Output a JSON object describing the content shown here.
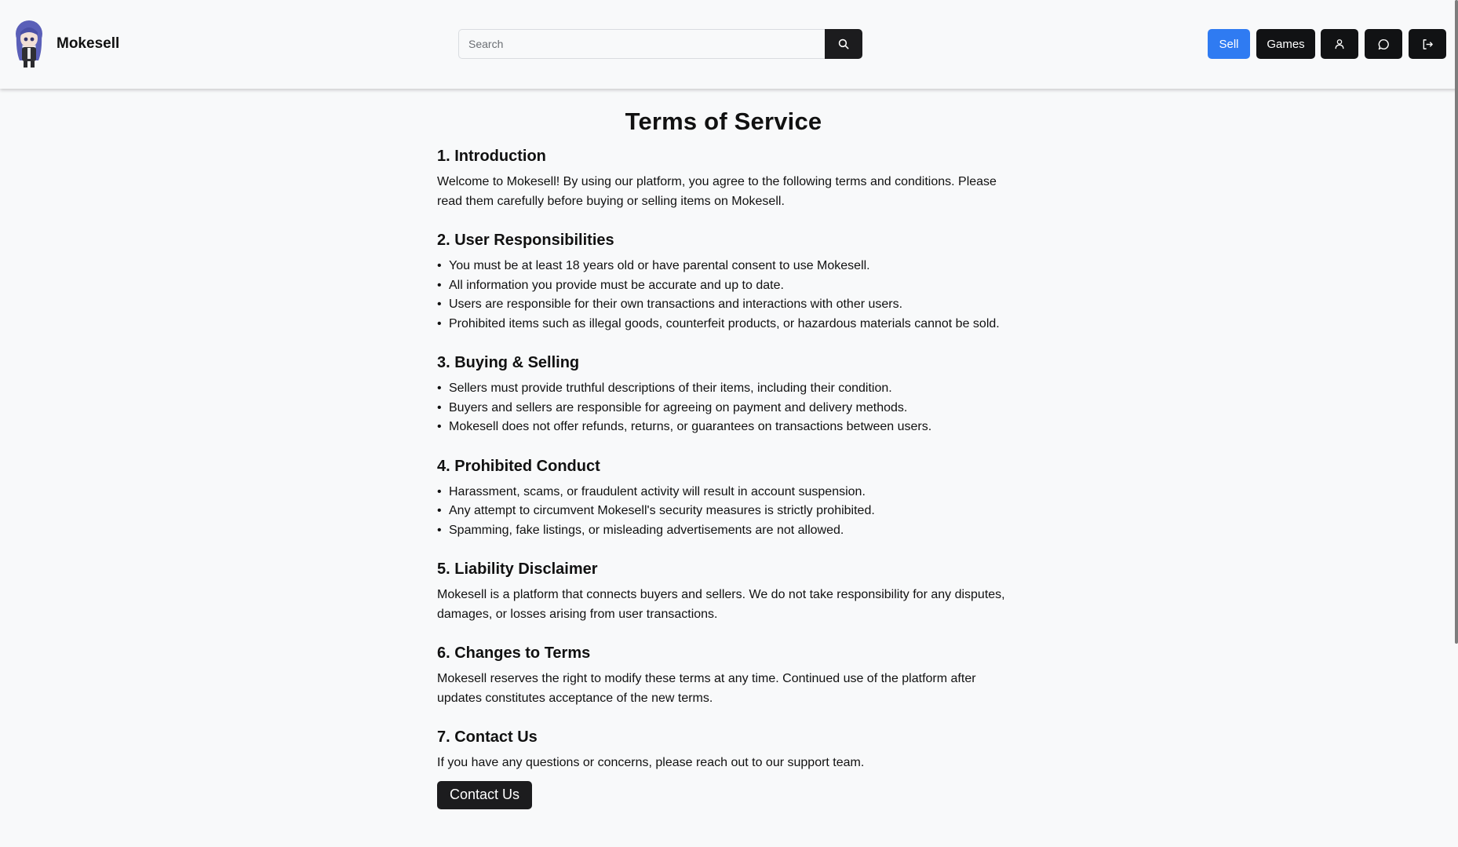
{
  "header": {
    "brand_name": "Mokesell",
    "search": {
      "placeholder": "Search",
      "value": ""
    },
    "buttons": {
      "sell_label": "Sell",
      "games_label": "Games"
    },
    "icons": [
      "search-icon",
      "user-icon",
      "chat-bubble-icon",
      "logout-icon"
    ],
    "colors": {
      "sell_accent": "#2f7bf2",
      "dark_button": "#111214"
    }
  },
  "page": {
    "title": "Terms of Service",
    "sections": [
      {
        "heading": "1. Introduction",
        "paragraph": "Welcome to Mokesell! By using our platform, you agree to the following terms and conditions. Please read them carefully before buying or selling items on Mokesell."
      },
      {
        "heading": "2. User Responsibilities",
        "items": [
          "You must be at least 18 years old or have parental consent to use Mokesell.",
          "All information you provide must be accurate and up to date.",
          "Users are responsible for their own transactions and interactions with other users.",
          "Prohibited items such as illegal goods, counterfeit products, or hazardous materials cannot be sold."
        ]
      },
      {
        "heading": "3. Buying & Selling",
        "items": [
          "Sellers must provide truthful descriptions of their items, including their condition.",
          "Buyers and sellers are responsible for agreeing on payment and delivery methods.",
          "Mokesell does not offer refunds, returns, or guarantees on transactions between users."
        ]
      },
      {
        "heading": "4. Prohibited Conduct",
        "items": [
          "Harassment, scams, or fraudulent activity will result in account suspension.",
          "Any attempt to circumvent Mokesell's security measures is strictly prohibited.",
          "Spamming, fake listings, or misleading advertisements are not allowed."
        ]
      },
      {
        "heading": "5. Liability Disclaimer",
        "paragraph": "Mokesell is a platform that connects buyers and sellers. We do not take responsibility for any disputes, damages, or losses arising from user transactions."
      },
      {
        "heading": "6. Changes to Terms",
        "paragraph": "Mokesell reserves the right to modify these terms at any time. Continued use of the platform after updates constitutes acceptance of the new terms."
      },
      {
        "heading": "7. Contact Us",
        "paragraph": "If you have any questions or concerns, please reach out to our support team."
      }
    ],
    "contact_button_label": "Contact Us"
  }
}
